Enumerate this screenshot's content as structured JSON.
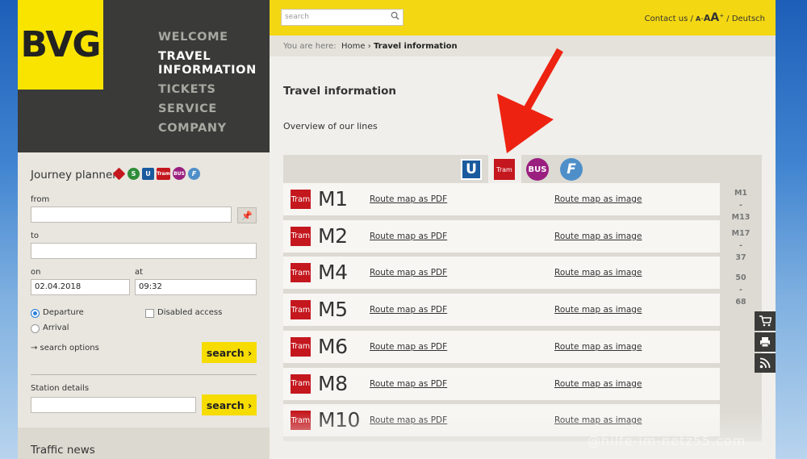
{
  "brand": {
    "logo": "BVG",
    "color": "#f9e400"
  },
  "nav": {
    "items": [
      {
        "label": "WELCOME"
      },
      {
        "label": "TRAVEL\nINFORMATION"
      },
      {
        "label": "TICKETS"
      },
      {
        "label": "SERVICE"
      },
      {
        "label": "COMPANY"
      }
    ]
  },
  "journey": {
    "title": "Journey planner",
    "mode_icons": [
      {
        "name": "regional-train-icon",
        "label": "RE",
        "color": "#c4171e"
      },
      {
        "name": "s-bahn-icon",
        "label": "S",
        "color": "#2f8d3a"
      },
      {
        "name": "u-bahn-icon",
        "label": "U",
        "color": "#1a5a9e"
      },
      {
        "name": "tram-icon",
        "label": "Tram",
        "color": "#c4171e"
      },
      {
        "name": "bus-icon",
        "label": "BUS",
        "color": "#9a1f7f"
      },
      {
        "name": "ferry-icon",
        "label": "F",
        "color": "#4f8fc9"
      }
    ],
    "from_label": "from",
    "from_value": "",
    "to_label": "to",
    "to_value": "",
    "on_label": "on",
    "on_value": "02.04.2018",
    "at_label": "at",
    "at_value": "09:32",
    "departure_label": "Departure",
    "arrival_label": "Arrival",
    "disabled_label": "Disabled access",
    "search_options": "→ search options",
    "search_label": "search ›",
    "station_label": "Station details",
    "station_value": "",
    "station_search_label": "search ›"
  },
  "traffic": {
    "title": "Traffic news"
  },
  "topbar": {
    "search_placeholder": "search",
    "contact": "Contact us /",
    "font_small": "A",
    "font_mid": "A",
    "font_big": "A",
    "language": "/ Deutsch"
  },
  "breadcrumb": {
    "prefix": "You are here:",
    "home": "Home",
    "sep": "›",
    "current": "Travel information"
  },
  "page": {
    "title": "Travel information",
    "subtitle": "Overview of our lines"
  },
  "mode_tabs": [
    {
      "name": "u-bahn-tab",
      "label": "U",
      "color": "#1a5a9e"
    },
    {
      "name": "tram-tab",
      "label": "Tram",
      "color": "#c4171e"
    },
    {
      "name": "bus-tab",
      "label": "BUS",
      "color": "#9a1f7f"
    },
    {
      "name": "ferry-tab",
      "label": "F",
      "color": "#4f8fc9"
    }
  ],
  "lines": [
    {
      "badge": "Tram",
      "number": "M1",
      "pdf": "Route map as PDF",
      "image": "Route map as image"
    },
    {
      "badge": "Tram",
      "number": "M2",
      "pdf": "Route map as PDF",
      "image": "Route map as image"
    },
    {
      "badge": "Tram",
      "number": "M4",
      "pdf": "Route map as PDF",
      "image": "Route map as image"
    },
    {
      "badge": "Tram",
      "number": "M5",
      "pdf": "Route map as PDF",
      "image": "Route map as image"
    },
    {
      "badge": "Tram",
      "number": "M6",
      "pdf": "Route map as PDF",
      "image": "Route map as image"
    },
    {
      "badge": "Tram",
      "number": "M8",
      "pdf": "Route map as PDF",
      "image": "Route map as image"
    },
    {
      "badge": "Tram",
      "number": "M10",
      "pdf": "Route map as PDF",
      "image": "Route map as image"
    }
  ],
  "ranges": [
    {
      "from": "M1",
      "sep": "-",
      "to": "M13"
    },
    {
      "from": "M17",
      "sep": "-",
      "to": "37"
    },
    {
      "from": "50",
      "sep": "-",
      "to": "68"
    }
  ],
  "side_tools": [
    "cart-icon",
    "printer-icon",
    "rss-icon"
  ],
  "annotation_color": "#ee2211"
}
